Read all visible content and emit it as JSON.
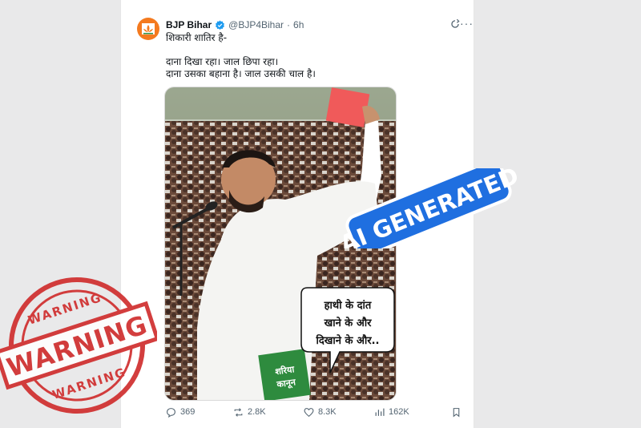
{
  "tweet": {
    "account_name": "BJP Bihar",
    "handle": "@BJP4Bihar",
    "separator": "·",
    "time": "6h",
    "more_label": "···",
    "lines": [
      "शिकारी शातिर है-",
      "दाना दिखा रहा। जाल छिपा रहा।",
      "दाना उसका बहाना है। जाल उसकी चाल है।"
    ],
    "image_speech_bubble": [
      "हाथी के दांत",
      "खाने के और",
      "दिखाने के और.."
    ],
    "book_label": [
      "शरिया",
      "कानून"
    ],
    "stats": {
      "replies": "369",
      "reposts": "2.8K",
      "likes": "8.3K",
      "views": "162K"
    }
  },
  "overlays": {
    "ai_badge": "AI GENERATED",
    "stamp_main": "WARNING",
    "stamp_top": "WARNING",
    "stamp_bottom": "WARNING"
  },
  "colors": {
    "brand_orange": "#f47a1f",
    "verified_blue": "#1d9bf0",
    "badge_blue": "#1f6fe0",
    "stamp_red": "#cf2a2a",
    "red_card": "#f05a5a",
    "book_green": "#2e8b3e"
  },
  "icons": [
    "bjp-lotus-icon",
    "verified-badge-icon",
    "grok-refresh-icon",
    "reply-icon",
    "repost-icon",
    "like-icon",
    "views-icon",
    "bookmark-icon"
  ]
}
